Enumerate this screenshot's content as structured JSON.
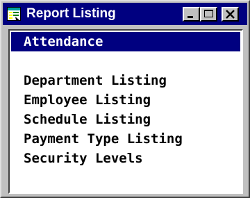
{
  "window": {
    "title": "Report Listing",
    "icon": "report-listing-app-icon",
    "controls": [
      "minimize-icon",
      "maximize-icon",
      "close-icon"
    ]
  },
  "list": {
    "selected_index": 0,
    "items": [
      "Attendance",
      "",
      "Department Listing",
      "Employee Listing",
      "Schedule Listing",
      "Payment Type Listing",
      "Security Levels"
    ]
  },
  "colors": {
    "title_bar": "#000080",
    "selection": "#000080",
    "window_face": "#c0c0c0",
    "list_background": "#ffffff"
  }
}
